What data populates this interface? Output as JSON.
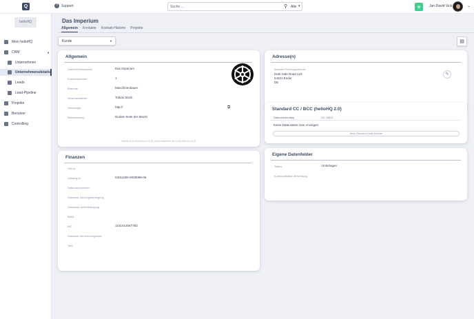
{
  "topbar": {
    "logo_letter": "Q",
    "support_label": "Support",
    "search_placeholder": "Suche ...",
    "search_scope": "Alle",
    "add_label": "+",
    "user_name": "Jan-David Vick"
  },
  "sidebar": {
    "tenant": "helloHQ",
    "items": [
      {
        "label": "Mein helloHQ"
      },
      {
        "label": "CRM"
      },
      {
        "label": "Unternehmen"
      },
      {
        "label": "Unternehmensdetails"
      },
      {
        "label": "Leads"
      },
      {
        "label": "Lead-Pipeline"
      },
      {
        "label": "Projekte"
      },
      {
        "label": "Benutzer"
      },
      {
        "label": "Controlling"
      }
    ]
  },
  "page": {
    "title": "Das Imperium",
    "tabs": [
      "Allgemein",
      "Kontakte",
      "Kontakt-Historie",
      "Projekte"
    ],
    "type_value": "Kunde"
  },
  "allgemein": {
    "title": "Allgemein",
    "fields": [
      {
        "label": "Unternehmensname",
        "value": "Das Imperium"
      },
      {
        "label": "Kundennummer",
        "value": "1"
      },
      {
        "label": "Branche",
        "value": "Maschinenbauer"
      },
      {
        "label": "Verantwortlicher",
        "value": "Tobias Stock"
      },
      {
        "label": "Homepage",
        "value": "http://"
      },
      {
        "label": "Beschreibung",
        "value": "Dunkle Seite der Macht"
      }
    ],
    "footnote": "Erstellt am 20.04.2018 um 13:38, Zuletzt bearbeitet am 24.04.2018 um 15:27"
  },
  "finanzen": {
    "title": "Finanzen",
    "fields": [
      {
        "label": "USt-Id",
        "value": ""
      },
      {
        "label": "Leitweg-Id",
        "value": "04011000-9000099-06"
      },
      {
        "label": "Debitorennummer",
        "value": ""
      },
      {
        "label": "Standard-Zahlungsbedingung",
        "value": ""
      },
      {
        "label": "Standard-Lieferbedingung",
        "value": ""
      },
      {
        "label": "IBAN",
        "value": ""
      },
      {
        "label": "BIC",
        "value": "12314145677B2"
      },
      {
        "label": "Standard-Verrechnungssatz",
        "value": ""
      },
      {
        "label": "Tarif",
        "value": ""
      }
    ]
  },
  "adressen": {
    "title": "Adresse(n)",
    "caption": "Standard-Rechnungsadresse",
    "lines": [
      "Dark Side Road 123",
      "54321 Endor",
      "DE"
    ]
  },
  "cc": {
    "title": "Standard CC / BCC (helloHQ 2.0)",
    "col1": "Datenelementtyp",
    "col2": "CC / BCC",
    "empty": "Keine Datensätze zum Anzeigen",
    "button": "Neue Standard-Email-Adresse"
  },
  "eigene": {
    "title": "Eigene Datenfelder",
    "fields": [
      {
        "label": "Status",
        "value": "Unterlagen"
      },
      {
        "label": "Kommunikation Bewertung",
        "value": ""
      }
    ]
  }
}
